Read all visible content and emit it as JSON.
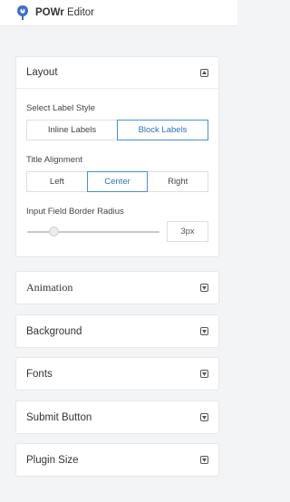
{
  "header": {
    "brand": "POWr",
    "title_suffix": "Editor"
  },
  "layout_panel": {
    "title": "Layout",
    "label_style": {
      "label": "Select Label Style",
      "options": [
        "Inline Labels",
        "Block Labels"
      ],
      "selected": "Block Labels"
    },
    "title_alignment": {
      "label": "Title Alignment",
      "options": [
        "Left",
        "Center",
        "Right"
      ],
      "selected": "Center"
    },
    "border_radius": {
      "label": "Input Field Border Radius",
      "value": "3px",
      "slider_fraction": 0.2
    }
  },
  "collapsed_panels": [
    {
      "title": "Animation"
    },
    {
      "title": "Background"
    },
    {
      "title": "Fonts"
    },
    {
      "title": "Submit Button"
    },
    {
      "title": "Plugin Size"
    }
  ],
  "colors": {
    "accent": "#4a8fd0",
    "logo": "#3f6fc9"
  }
}
